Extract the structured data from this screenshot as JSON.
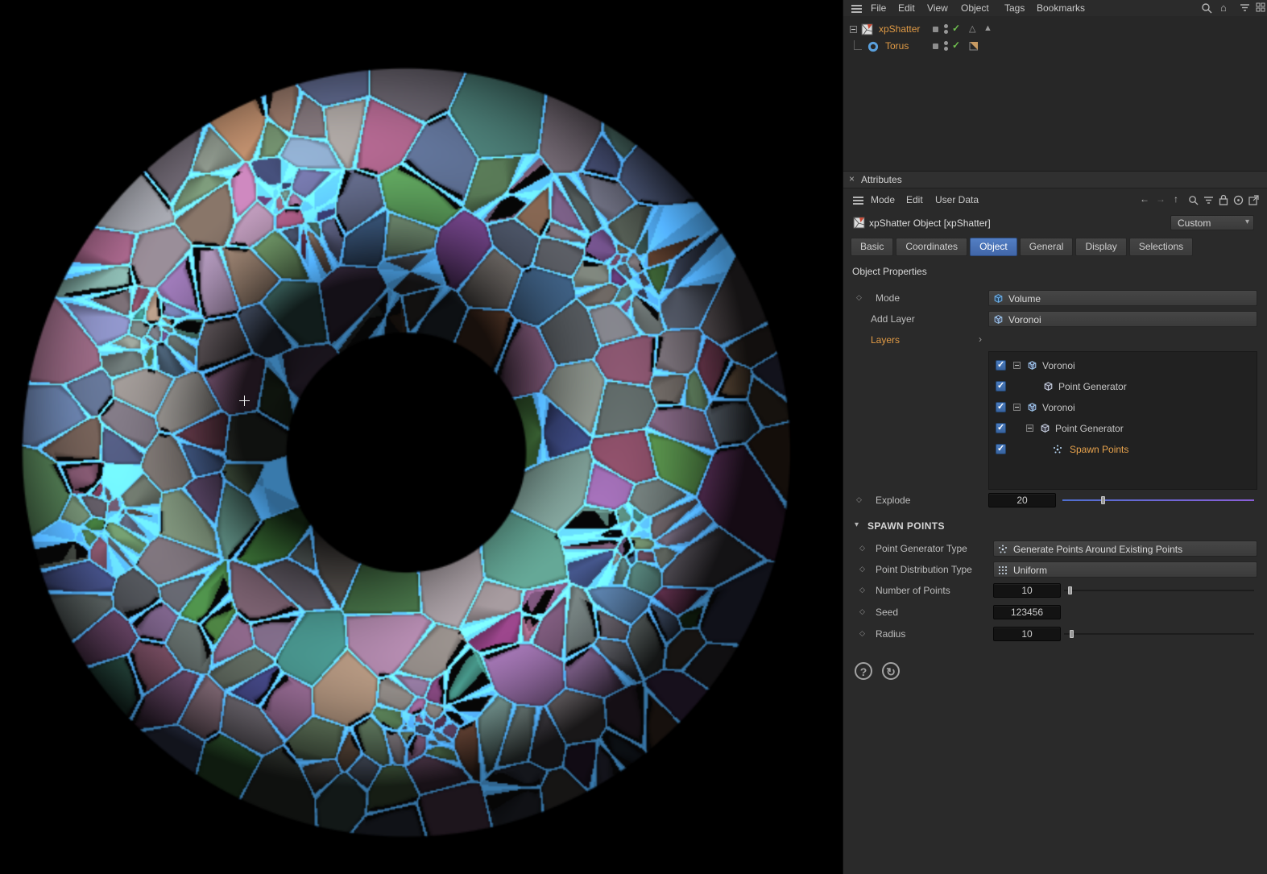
{
  "colors": {
    "accent_orange": "#E09A45",
    "highlight_blue": "#4472B8",
    "check_green": "#6FBF4F",
    "wire_blue": "#55B0FF",
    "panel_bg": "#2A2A2A"
  },
  "icons": {
    "check": "✓",
    "triangle_outline": "△",
    "triangle_filled": "▲",
    "chevron_down": "▾",
    "chevron_right": "›",
    "close": "×",
    "arrow_left": "←",
    "arrow_right": "→",
    "arrow_up": "↑",
    "home": "⌂",
    "question": "?",
    "reload": "↻",
    "diamond": "◇"
  },
  "menu_bar": {
    "items": [
      "File",
      "Edit",
      "View",
      "Object",
      "Tags",
      "Bookmarks"
    ]
  },
  "object_manager": {
    "items": [
      {
        "label": "xpShatter"
      },
      {
        "label": "Torus"
      }
    ]
  },
  "attributes": {
    "title": "Attributes",
    "menu": [
      "Mode",
      "Edit",
      "User Data"
    ],
    "object_title": "xpShatter Object [xpShatter]",
    "preset_dropdown": "Custom",
    "tabs": [
      {
        "label": "Basic"
      },
      {
        "label": "Coordinates"
      },
      {
        "label": "Object",
        "active": true
      },
      {
        "label": "General"
      },
      {
        "label": "Display"
      },
      {
        "label": "Selections"
      }
    ],
    "section_title": "Object Properties",
    "mode": {
      "label": "Mode",
      "value": "Volume"
    },
    "add_layer": {
      "label": "Add Layer",
      "value": "Voronoi"
    },
    "layers_label": "Layers",
    "layers": [
      {
        "label": "Voronoi",
        "checked": true
      },
      {
        "label": "Point Generator",
        "checked": true
      },
      {
        "label": "Voronoi",
        "checked": true
      },
      {
        "label": "Point Generator",
        "checked": true
      },
      {
        "label": "Spawn Points",
        "checked": true,
        "selected": true
      }
    ],
    "explode": {
      "label": "Explode",
      "value": "20"
    },
    "spawn_section": "SPAWN POINTS",
    "point_generator_type": {
      "label": "Point Generator Type",
      "value": "Generate Points Around Existing Points"
    },
    "point_distribution_type": {
      "label": "Point Distribution Type",
      "value": "Uniform"
    },
    "number_of_points": {
      "label": "Number of Points",
      "value": "10"
    },
    "seed": {
      "label": "Seed",
      "value": "123456"
    },
    "radius": {
      "label": "Radius",
      "value": "10"
    }
  }
}
